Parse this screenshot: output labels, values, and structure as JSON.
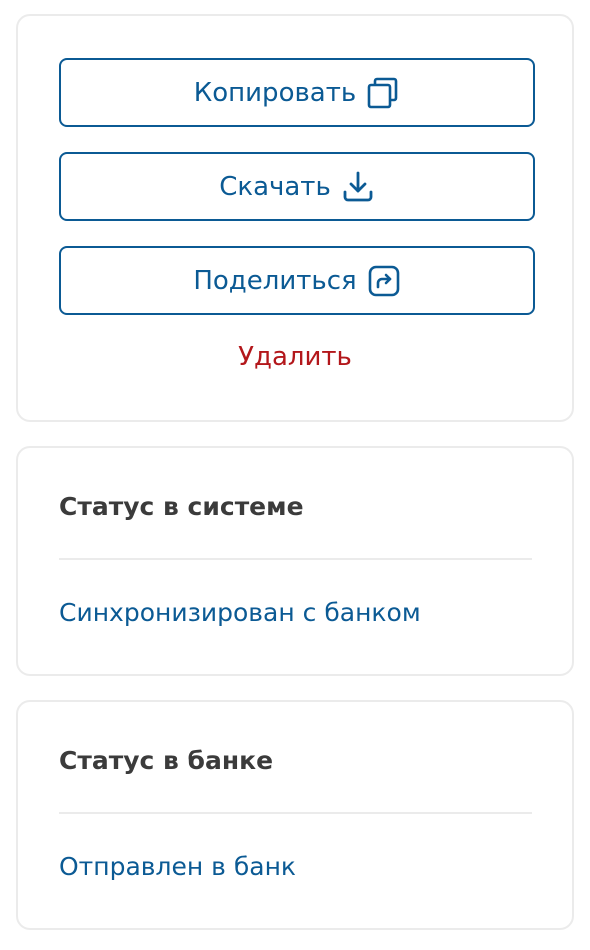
{
  "actions": {
    "copy_label": "Копировать",
    "download_label": "Скачать",
    "share_label": "Поделиться",
    "delete_label": "Удалить",
    "icons": {
      "copy": "copy-icon",
      "download": "download-icon",
      "share": "share-icon"
    }
  },
  "system_status": {
    "title": "Статус в системе",
    "value": "Синхронизирован с банком"
  },
  "bank_status": {
    "title": "Статус в банке",
    "value": "Отправлен в банк"
  },
  "colors": {
    "primary": "#0b5a94",
    "danger": "#b3171b",
    "title_text": "#3b3b3b",
    "border": "#ebebeb"
  }
}
